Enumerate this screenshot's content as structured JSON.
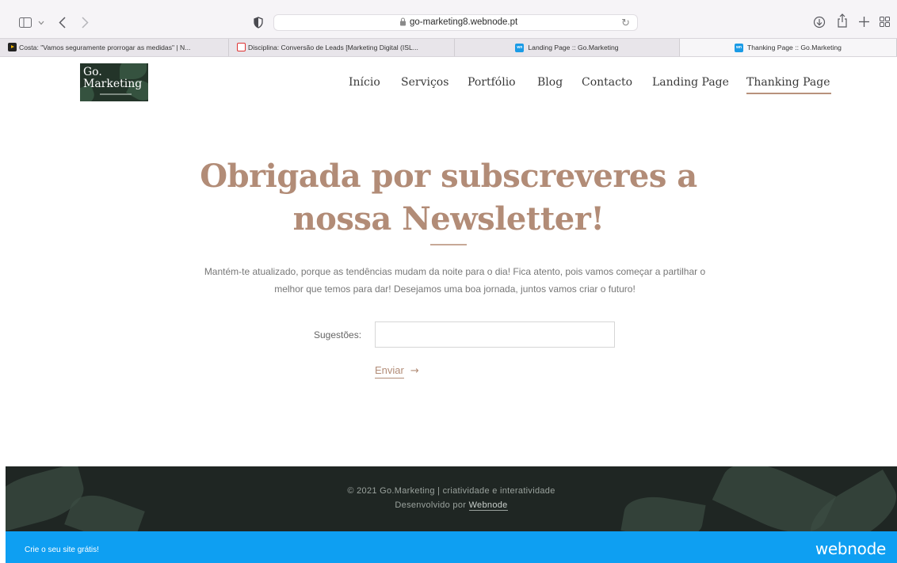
{
  "browser": {
    "url": "go-marketing8.webnode.pt",
    "icons": {
      "sidebar": "sidebar-icon",
      "sidebar_menu": "chevron-down-icon",
      "back": "back-icon",
      "forward": "forward-icon",
      "shield": "shield-icon",
      "lock": "lock-icon",
      "reload": "reload-icon",
      "download": "download-icon",
      "share": "share-icon",
      "new_tab": "plus-icon",
      "tab_overview": "tab-grid-icon"
    },
    "tabs": [
      {
        "title": "Costa: \"Vamos seguramente prorrogar as medidas\" | N...",
        "icon": "video-icon"
      },
      {
        "title": "Disciplina: Conversão de Leads [Marketing Digital (ISL...",
        "icon": "document-icon"
      },
      {
        "title": "Landing Page :: Go.Marketing",
        "icon": "webnode-icon"
      },
      {
        "title": "Thanking Page :: Go.Marketing",
        "icon": "webnode-icon",
        "active": true
      }
    ]
  },
  "site": {
    "logo": {
      "line1": "Go.",
      "line2": "Marketing"
    },
    "nav": [
      {
        "label": "Início"
      },
      {
        "label": "Serviços"
      },
      {
        "label": "Portfólio"
      },
      {
        "label": "Blog"
      },
      {
        "label": "Contacto"
      },
      {
        "label": "Landing Page"
      },
      {
        "label": "Thanking Page",
        "active": true
      }
    ]
  },
  "main": {
    "headline_line1": "Obrigada por subscreveres a",
    "headline_line2": "nossa Newsletter!",
    "body_line1": "Mantém-te atualizado, porque as tendências mudam da noite para o dia! Fica atento, pois vamos começar a partilhar o",
    "body_line2": "melhor que temos para dar! Desejamos uma boa jornada, juntos vamos criar o futuro!",
    "form": {
      "label": "Sugestões:",
      "value": "",
      "placeholder": "",
      "submit_label": "Enviar",
      "submit_arrow": "→"
    }
  },
  "footer": {
    "copyright": "© 2021 Go.Marketing | criatividade e interatividade",
    "developed_prefix": "Desenvolvido por",
    "developed_link": "Webnode"
  },
  "banner": {
    "cta": "Crie o seu site grátis!",
    "brand": "webnode"
  },
  "colors": {
    "accent": "#b28c77",
    "banner": "#0e9ff2",
    "footer_bg": "#1f2623"
  }
}
